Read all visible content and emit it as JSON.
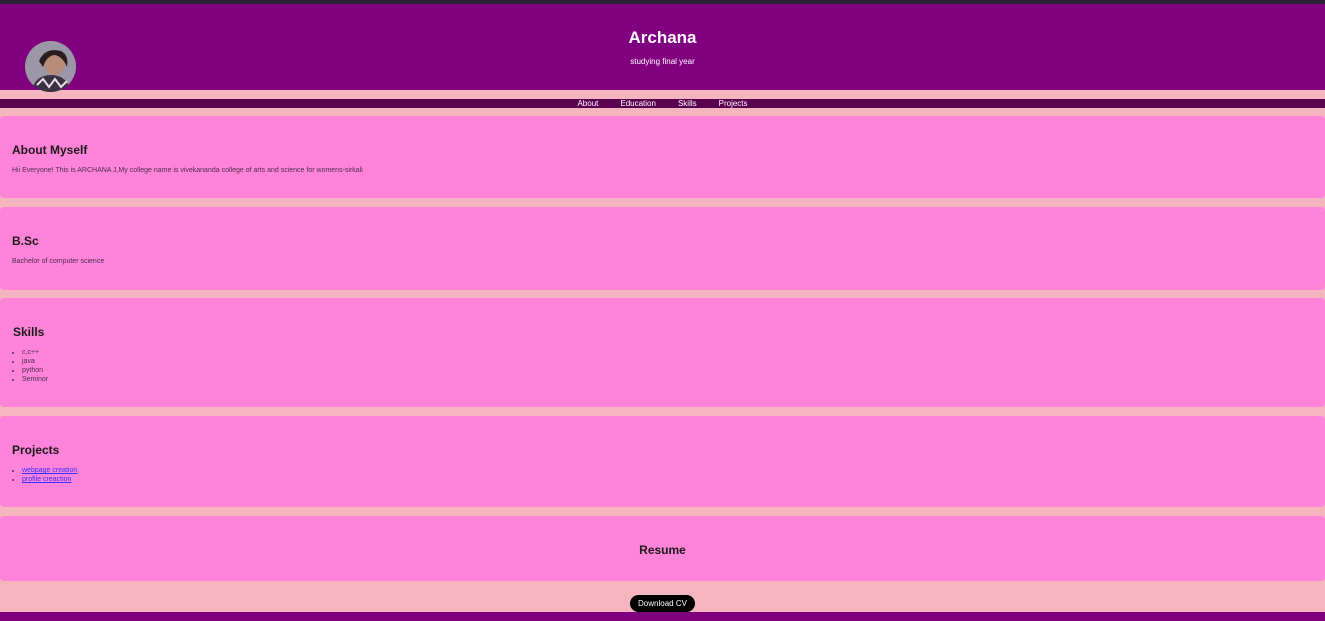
{
  "header": {
    "name": "Archana",
    "subtitle": "studying final year"
  },
  "nav": {
    "items": [
      "About",
      "Education",
      "Skills",
      "Projects"
    ]
  },
  "about": {
    "heading": "About Myself",
    "text": "Hii Everyone! This is ARCHANA J,My college name is vivekananda college of arts and science for womens-sirkali"
  },
  "education": {
    "heading": "B.Sc",
    "text": "Bachelor of computer science"
  },
  "skills": {
    "heading": "Skills",
    "items": [
      "c,c++",
      "java",
      "python",
      "Seminor"
    ]
  },
  "projects": {
    "heading": "Projects",
    "items": [
      "webpage creation",
      "profile creaction"
    ]
  },
  "resume": {
    "heading": "Resume",
    "button_label": "Download CV"
  },
  "colors": {
    "header_bg": "#800080",
    "nav_bg": "#5a0050",
    "card_bg": "#ff83d8",
    "page_bg": "#f5b5bf"
  }
}
